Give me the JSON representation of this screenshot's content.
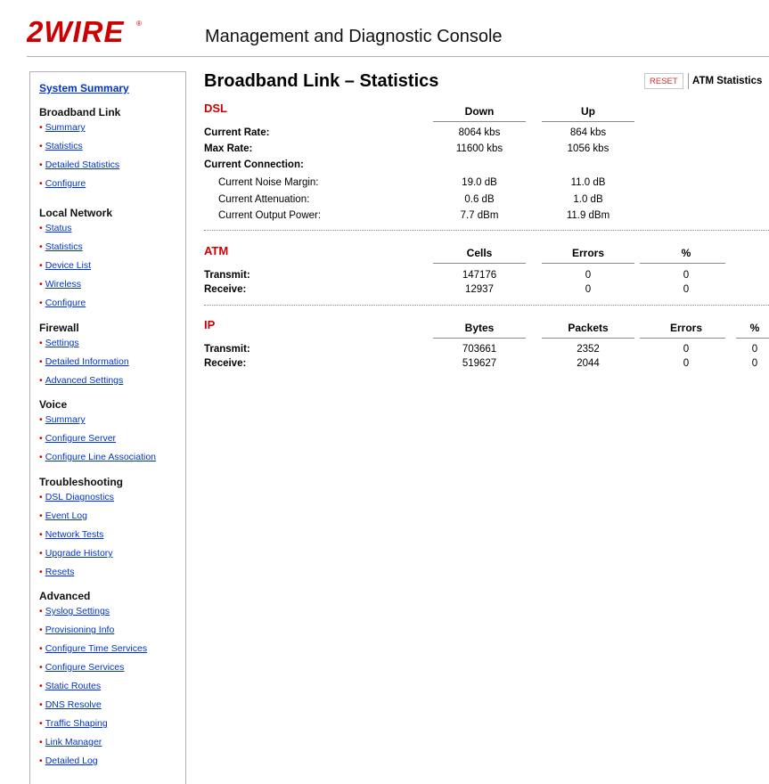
{
  "header": {
    "logo_text": "2WIRE",
    "console_title": "Management and Diagnostic Console"
  },
  "sidebar": {
    "top_link": "System Summary",
    "sections": [
      {
        "title": "Broadband Link",
        "links": [
          "Summary",
          "Statistics",
          "Detailed Statistics",
          "Configure"
        ]
      },
      {
        "title": "Local Network",
        "links": [
          "Status",
          "Statistics",
          "Device List",
          "Wireless",
          "Configure"
        ]
      },
      {
        "title": "Firewall",
        "links": [
          "Settings",
          "Detailed Information",
          "Advanced Settings"
        ]
      },
      {
        "title": "Voice",
        "links": [
          "Summary",
          "Configure Server",
          "Configure Line Association"
        ]
      },
      {
        "title": "Troubleshooting",
        "links": [
          "DSL Diagnostics",
          "Event Log",
          "Network Tests",
          "Upgrade History",
          "Resets"
        ]
      },
      {
        "title": "Advanced",
        "links": [
          "Syslog Settings",
          "Provisioning Info",
          "Configure Time Services",
          "Configure Services",
          "Static Routes",
          "DNS Resolve",
          "Traffic Shaping",
          "Link Manager",
          "Detailed Log"
        ]
      }
    ]
  },
  "main": {
    "title": "Broadband Link – Statistics",
    "reset_label": "RESET",
    "atm_stats_label": "ATM Statistics",
    "dsl": {
      "title": "DSL",
      "columns": [
        "Down",
        "Up"
      ],
      "current_rate": {
        "label": "Current Rate:",
        "values": [
          "8064 kbs",
          "864 kbs"
        ]
      },
      "max_rate": {
        "label": "Max Rate:",
        "values": [
          "11600 kbs",
          "1056 kbs"
        ]
      },
      "current_connection": "Current Connection:",
      "noise_margin": {
        "label": "Current Noise Margin:",
        "values": [
          "19.0 dB",
          "11.0 dB"
        ]
      },
      "attenuation": {
        "label": "Current Attenuation:",
        "values": [
          "0.6 dB",
          "1.0 dB"
        ]
      },
      "output_power": {
        "label": "Current Output Power:",
        "values": [
          "7.7 dBm",
          "11.9 dBm"
        ]
      }
    },
    "atm": {
      "title": "ATM",
      "columns": [
        "Cells",
        "Errors",
        "%"
      ],
      "transmit": {
        "label": "Transmit:",
        "values": [
          "147176",
          "0",
          "0"
        ]
      },
      "receive": {
        "label": "Receive:",
        "values": [
          "12937",
          "0",
          "0"
        ]
      }
    },
    "ip": {
      "title": "IP",
      "columns": [
        "Bytes",
        "Packets",
        "Errors",
        "%"
      ],
      "transmit": {
        "label": "Transmit:",
        "values": [
          "703661",
          "2352",
          "0",
          "0"
        ]
      },
      "receive": {
        "label": "Receive:",
        "values": [
          "519627",
          "2044",
          "0",
          "0"
        ]
      }
    }
  },
  "colors": {
    "brand_red": "#cc0000",
    "link_blue": "#0033cc"
  }
}
